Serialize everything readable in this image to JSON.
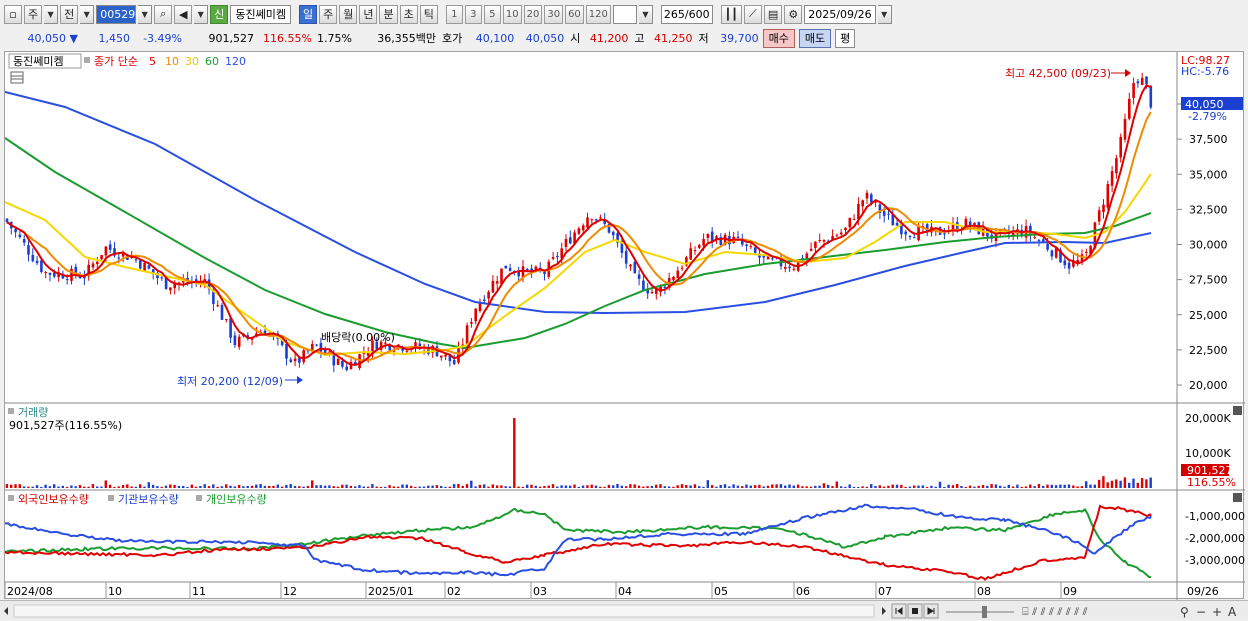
{
  "toolbar": {
    "market_btn": "주",
    "type_btn": "전",
    "code": "005290",
    "new_badge": "신",
    "stock_name": "동진쎄미켐",
    "period_tabs": [
      "일",
      "주",
      "월",
      "년",
      "분",
      "초",
      "틱"
    ],
    "active_period": "일",
    "interval_btns": [
      "1",
      "3",
      "5",
      "10",
      "20",
      "30",
      "60",
      "120"
    ],
    "count_value": "265",
    "count_total": "/600",
    "date_value": "2025/09/26"
  },
  "quote": {
    "price": "40,050",
    "change_arrow": "▼",
    "change": "1,450",
    "change_pct": "-3.49%",
    "volume": "901,527",
    "volume_ratio": "116.55%",
    "turnover": "1.75%",
    "trade_value": "36,355백만",
    "ask_label": "호가",
    "ask": "40,100",
    "bid": "40,050",
    "open_label": "시",
    "open": "41,200",
    "high_label": "고",
    "high": "41,250",
    "low_label": "저",
    "low": "39,700",
    "buy_btn": "매수",
    "sell_btn": "매도",
    "eval_btn": "평"
  },
  "price_panel": {
    "title": "동진쎄미켐",
    "legend_prefix": "종가 단순",
    "ma_labels": [
      "5",
      "10",
      "30",
      "60",
      "120"
    ],
    "lc": "LC:98.27",
    "hc": "HC:-5.76",
    "current_price_label": "40,050",
    "current_pct_label": "-2.79%",
    "high_annotation": "최고 42,500 (09/23)",
    "low_annotation": "최저 20,200 (12/09)",
    "dividend_annotation": "배당락(0.00%)",
    "y_ticks": [
      "40,000",
      "37,500",
      "35,000",
      "32,500",
      "30,000",
      "27,500",
      "25,000",
      "22,500",
      "20,000"
    ]
  },
  "volume_panel": {
    "title": "거래량",
    "value_label": "901,527주(116.55%)",
    "y_ticks": [
      "20,000K",
      "10,000K"
    ],
    "current_label": "901,527",
    "current_pct": "116.55%"
  },
  "holding_panel": {
    "legend": [
      "외국인보유수량",
      "기관보유수량",
      "개인보유수량"
    ],
    "y_ticks": [
      "-1,000,000",
      "-2,000,000",
      "-3,000,000"
    ]
  },
  "x_axis": {
    "labels": [
      "2024/08",
      "10",
      "11",
      "12",
      "2025/01",
      "02",
      "03",
      "04",
      "05",
      "06",
      "07",
      "08",
      "09"
    ],
    "right_label": "09/26"
  },
  "colors": {
    "ma5": "#e00000",
    "ma10": "#f08a00",
    "ma30": "#f5d800",
    "ma60": "#1a9c2f",
    "ma120": "#2a4fe0",
    "candle_up": "#e00000",
    "candle_down": "#1a3fd1"
  },
  "bottom_icons": [
    "pan-left-icon",
    "play-icon",
    "first-icon",
    "prev-icon",
    "stop-icon",
    "next-icon"
  ]
}
